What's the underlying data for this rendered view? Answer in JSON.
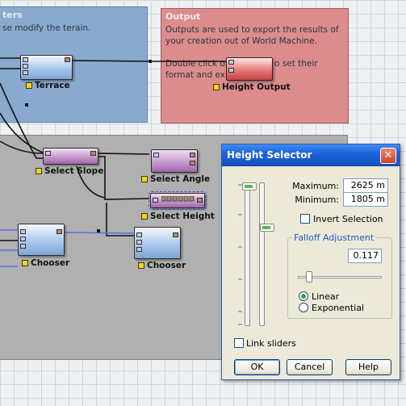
{
  "groups": {
    "modifiers": {
      "title": "ters",
      "description": "se modify the terain."
    },
    "output": {
      "title": "Output",
      "description": [
        "Outputs are used to export the results of",
        "your creation out of World Machine.",
        "",
        "Double click on",
        "format and expo"
      ],
      "description_tail": "o set their"
    }
  },
  "nodes": [
    {
      "id": "terrace",
      "label": "Terrace"
    },
    {
      "id": "height-output",
      "label": "Height Output"
    },
    {
      "id": "select-slope",
      "label": "Select Slope"
    },
    {
      "id": "select-angle",
      "label": "Select Angle"
    },
    {
      "id": "select-height",
      "label": "Select Height"
    },
    {
      "id": "chooser-1",
      "label": "Chooser"
    },
    {
      "id": "chooser-2",
      "label": "Chooser"
    }
  ],
  "dialog": {
    "title": "Height Selector",
    "close_glyph": "✕",
    "maximum_label": "Maximum:",
    "maximum_value": "2625 m",
    "minimum_label": "Minimum:",
    "minimum_value": "1805 m",
    "invert_selection_label": "Invert Selection",
    "invert_selection_checked": false,
    "falloff_legend": "Falloff Adjustment",
    "falloff_value": "0.117",
    "falloff_mode_options": [
      "Linear",
      "Exponential"
    ],
    "falloff_mode_selected": "Linear",
    "link_sliders_label": "Link sliders",
    "link_sliders_checked": false,
    "ok_label": "OK",
    "cancel_label": "Cancel",
    "help_label": "Help"
  },
  "colors": {
    "modifiers_group": "#8aa9cf",
    "output_group": "#dc8c8c",
    "selection_group": "#b0b0b0",
    "titlebar": "#1c62d9",
    "accent_label": "#f6d700"
  }
}
